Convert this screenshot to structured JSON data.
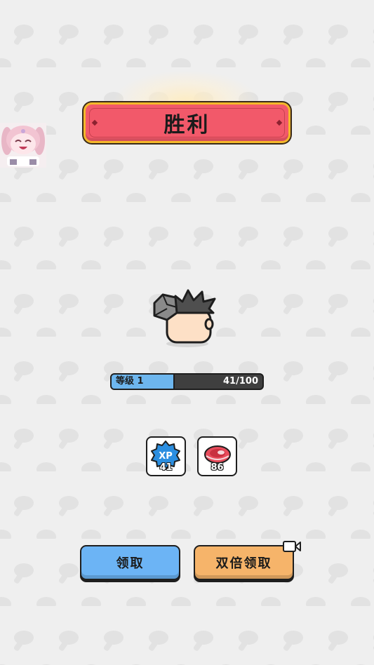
{
  "result": {
    "title": "胜利"
  },
  "level": {
    "label": "等级 1",
    "progress_text": "41/100",
    "progress": 0.41
  },
  "rewards": [
    {
      "icon": "xp-icon",
      "badge_text": "XP",
      "count": "41"
    },
    {
      "icon": "meat-icon",
      "count": "86"
    }
  ],
  "buttons": {
    "claim_label": "领取",
    "double_claim_label": "双倍领取"
  },
  "colors": {
    "banner": "#f2596a",
    "banner_border": "#f4b82a",
    "claim_button": "#6cb4f5",
    "double_button": "#f6b46a",
    "level_fill": "#6db6ee",
    "background": "#efefef"
  }
}
